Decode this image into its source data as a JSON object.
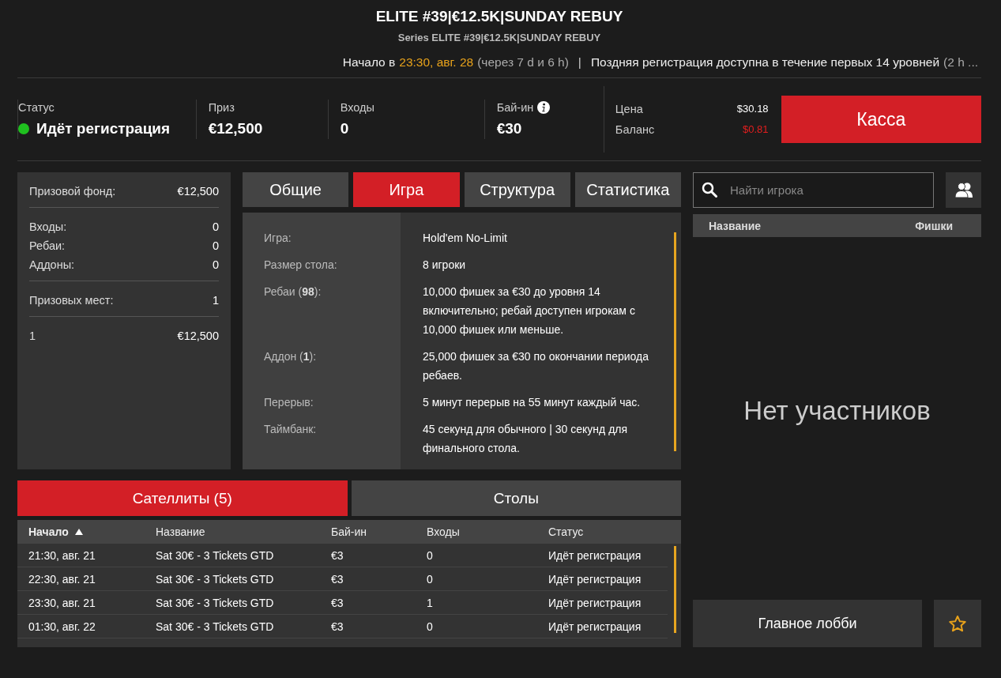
{
  "header": {
    "title": "ELITE #39|€12.5K|SUNDAY REBUY",
    "subtitle": "Series ELITE #39|€12.5K|SUNDAY REBUY",
    "start_label": "Начало в",
    "start_time": "23:30, авг. 28",
    "countdown": "(через 7 d и 6 h)",
    "separator": "|",
    "late_registration": "Поздняя регистрация доступна в течение первых 14 уровней",
    "late_registration_more": "(2 h ..."
  },
  "stats": [
    {
      "kind": "status",
      "label": "Статус",
      "value": "Идёт регистрация",
      "color": "#1fc01f"
    },
    {
      "kind": "plain",
      "label": "Приз",
      "value": "€12,500"
    },
    {
      "kind": "plain",
      "label": "Входы",
      "value": "0"
    },
    {
      "kind": "info",
      "label": "Бай-ин",
      "value": "€30"
    }
  ],
  "account": {
    "price_label": "Цена",
    "price": "$30.18",
    "balance_label": "Баланс",
    "balance": "$0.81"
  },
  "cashier_button": "Касса",
  "prize_panel": [
    [
      {
        "label": "Призовой фонд:",
        "value": "€12,500"
      }
    ],
    [
      {
        "label": "Входы:",
        "value": "0"
      },
      {
        "label": "Ребаи:",
        "value": "0"
      },
      {
        "label": "Аддоны:",
        "value": "0"
      }
    ],
    [
      {
        "label": "Призовых мест:",
        "value": "1"
      }
    ],
    [
      {
        "label": "1",
        "value": "€12,500"
      }
    ]
  ],
  "info_tabs": [
    {
      "label": "Общие",
      "selected": false
    },
    {
      "label": "Игра",
      "selected": true
    },
    {
      "label": "Структура",
      "selected": false
    },
    {
      "label": "Статистика",
      "selected": false
    }
  ],
  "game_info": [
    {
      "label": "Игра:",
      "value": "Hold'em No-Limit"
    },
    {
      "label": "Размер стола:",
      "value": "8 игроки"
    },
    {
      "label": "Ребаи (**98**):",
      "value": "10,000 фишек за €30 до уровня 14 включительно; ребай доступен игрокам с 10,000 фишек или меньше."
    },
    {
      "label": "Аддон (**1**):",
      "value": "25,000 фишек за €30 по окончании периода ребаев."
    },
    {
      "label": "Перерыв:",
      "value": "5 минут перерыв на 55 минут каждый час."
    },
    {
      "label": "Таймбанк:",
      "value": "45 секунд для обычного | 30 секунд для финального стола."
    }
  ],
  "players": {
    "search_placeholder": "Найти игрока",
    "columns": [
      "Название",
      "Фишки"
    ],
    "empty_message": "Нет участников"
  },
  "lobby_button": "Главное лобби",
  "bottom_tabs": [
    {
      "label": "Сателлиты (5)",
      "selected": true
    },
    {
      "label": "Столы",
      "selected": false
    }
  ],
  "satellites": {
    "columns": [
      {
        "label": "Начало",
        "sorted": true
      },
      {
        "label": "Название",
        "sorted": false
      },
      {
        "label": "Бай-ин",
        "sorted": false
      },
      {
        "label": "Входы",
        "sorted": false
      },
      {
        "label": "Статус",
        "sorted": false
      }
    ],
    "rows": [
      [
        "21:30, авг. 21",
        "Sat 30€ - 3 Tickets GTD",
        "€3",
        "0",
        "Идёт регистрация"
      ],
      [
        "22:30, авг. 21",
        "Sat 30€ - 3 Tickets GTD",
        "€3",
        "0",
        "Идёт регистрация"
      ],
      [
        "23:30, авг. 21",
        "Sat 30€ - 3 Tickets GTD",
        "€3",
        "1",
        "Идёт регистрация"
      ],
      [
        "01:30, авг. 22",
        "Sat 30€ - 3 Tickets GTD",
        "€3",
        "0",
        "Идёт регистрация"
      ]
    ]
  }
}
